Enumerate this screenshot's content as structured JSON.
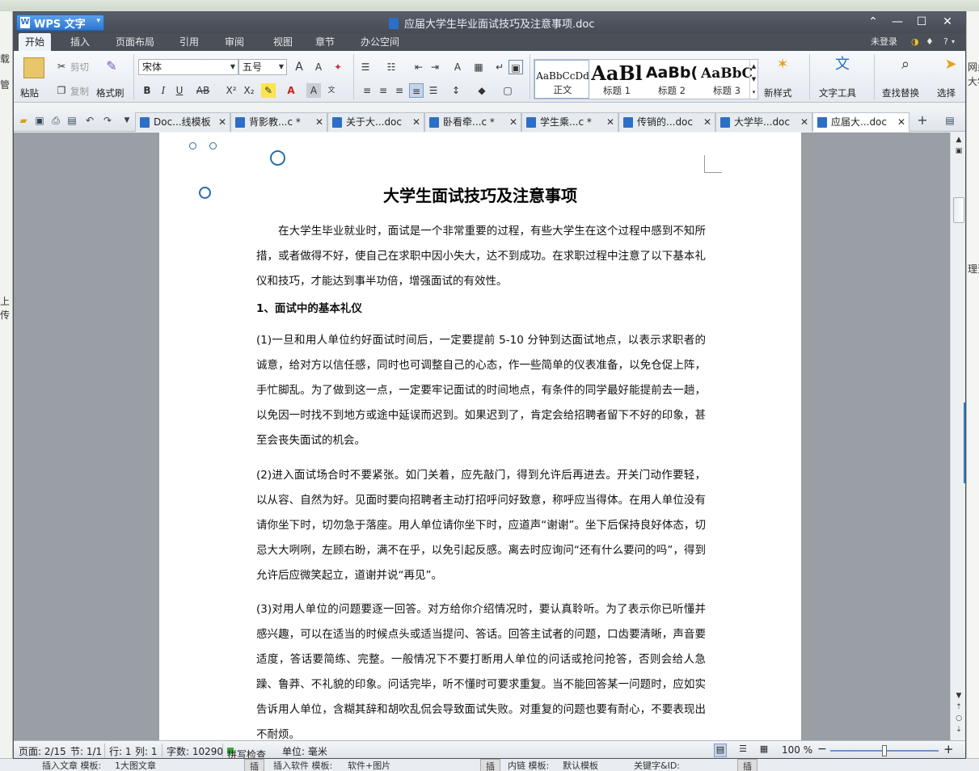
{
  "window": {
    "app_name": "WPS 文字",
    "doc_title": "应届大学生毕业面试技巧及注意事项.doc",
    "controls": [
      "⌃",
      "—",
      "☐",
      "✕"
    ]
  },
  "menu": {
    "tabs": [
      "开始",
      "插入",
      "页面布局",
      "引用",
      "审阅",
      "视图",
      "章节",
      "办公空间"
    ],
    "login": "未登录",
    "help": "?"
  },
  "ribbon": {
    "paste": "粘贴",
    "cut": "剪切",
    "copy": "复制",
    "format_painter": "格式刷",
    "font_name": "宋体",
    "font_size": "五号",
    "bold": "B",
    "italic": "I",
    "underline": "U",
    "strike": "AB",
    "superscript": "X²",
    "subscript": "X₂",
    "styles": [
      {
        "preview": "AaBbCcDd",
        "label": "正文"
      },
      {
        "preview": "AaBl",
        "label": "标题 1"
      },
      {
        "preview": "AaBb(",
        "label": "标题 2"
      },
      {
        "preview": "AaBbC",
        "label": "标题 3"
      }
    ],
    "new_style": "新样式",
    "text_tools": "文字工具",
    "find_replace": "查找替换",
    "select": "选择"
  },
  "doc_tabs": [
    {
      "label": "Doc...线模板",
      "active": false
    },
    {
      "label": "背影教...c *",
      "active": false
    },
    {
      "label": "关于大...doc",
      "active": false
    },
    {
      "label": "卧看牵...c *",
      "active": false
    },
    {
      "label": "学生乘...c *",
      "active": false
    },
    {
      "label": "传销的...doc",
      "active": false
    },
    {
      "label": "大学毕...doc",
      "active": false
    },
    {
      "label": "应届大...doc",
      "active": true
    }
  ],
  "document": {
    "title": "大学生面试技巧及注意事项",
    "intro": "在大学生毕业就业时，面试是一个非常重要的过程，有些大学生在这个过程中感到不知所措，或者做得不好，使自己在求职中因小失大，达不到成功。在求职过程中注意了以下基本礼仪和技巧，才能达到事半功倍，增强面试的有效性。",
    "heading1": "1、面试中的基本礼仪",
    "p1": "(1)一旦和用人单位约好面试时间后，一定要提前 5-10 分钟到达面试地点，以表示求职者的诚意，给对方以信任感，同时也可调整自己的心态，作一些简单的仪表准备，以免仓促上阵，手忙脚乱。为了做到这一点，一定要牢记面试的时间地点，有条件的同学最好能提前去一趟，以免因一时找不到地方或途中延误而迟到。如果迟到了，肯定会给招聘者留下不好的印象，甚至会丧失面试的机会。",
    "p2": "(2)进入面试场合时不要紧张。如门关着，应先敲门，得到允许后再进去。开关门动作要轻，以从容、自然为好。见面时要向招聘者主动打招呼问好致意，称呼应当得体。在用人单位没有请你坐下时，切勿急于落座。用人单位请你坐下时，应道声“谢谢”。坐下后保持良好体态，切忌大大咧咧，左顾右盼，满不在乎，以免引起反感。离去时应询问“还有什么要问的吗”，得到允许后应微笑起立，道谢并说“再见”。",
    "p3": "(3)对用人单位的问题要逐一回答。对方给你介绍情况时，要认真聆听。为了表示你已听懂并感兴趣，可以在适当的时候点头或适当提问、答话。回答主试者的问题，口齿要清晰，声音要适度，答话要简练、完整。一般情况下不要打断用人单位的问话或抢问抢答，否则会给人急躁、鲁莽、不礼貌的印象。问话完毕，听不懂时可要求重复。当不能回答某一问题时，应如实告诉用人单位，含糊其辞和胡吹乱侃会导致面试失败。对重复的问题也要有耐心，不要表现出不耐烦。"
  },
  "status": {
    "page": "页面: 2/15",
    "section": "节: 1/1",
    "row": "行: 1",
    "col": "列: 1",
    "words": "字数: 10290",
    "spell": "拼写检查",
    "unit": "单位: 毫米",
    "zoom": "100 %",
    "zoom_level": 0.5
  },
  "background": {
    "left": [
      "管",
      "载",
      "上传"
    ],
    "right": [
      "网盘",
      "大学",
      "理资"
    ],
    "bottom": [
      "插入文章 模板:",
      "1大图文章",
      "插",
      "插入软件 模板:",
      "软件+图片",
      "插",
      "内链 模板:",
      "默认模板",
      "关键字&ID:",
      "插"
    ]
  }
}
